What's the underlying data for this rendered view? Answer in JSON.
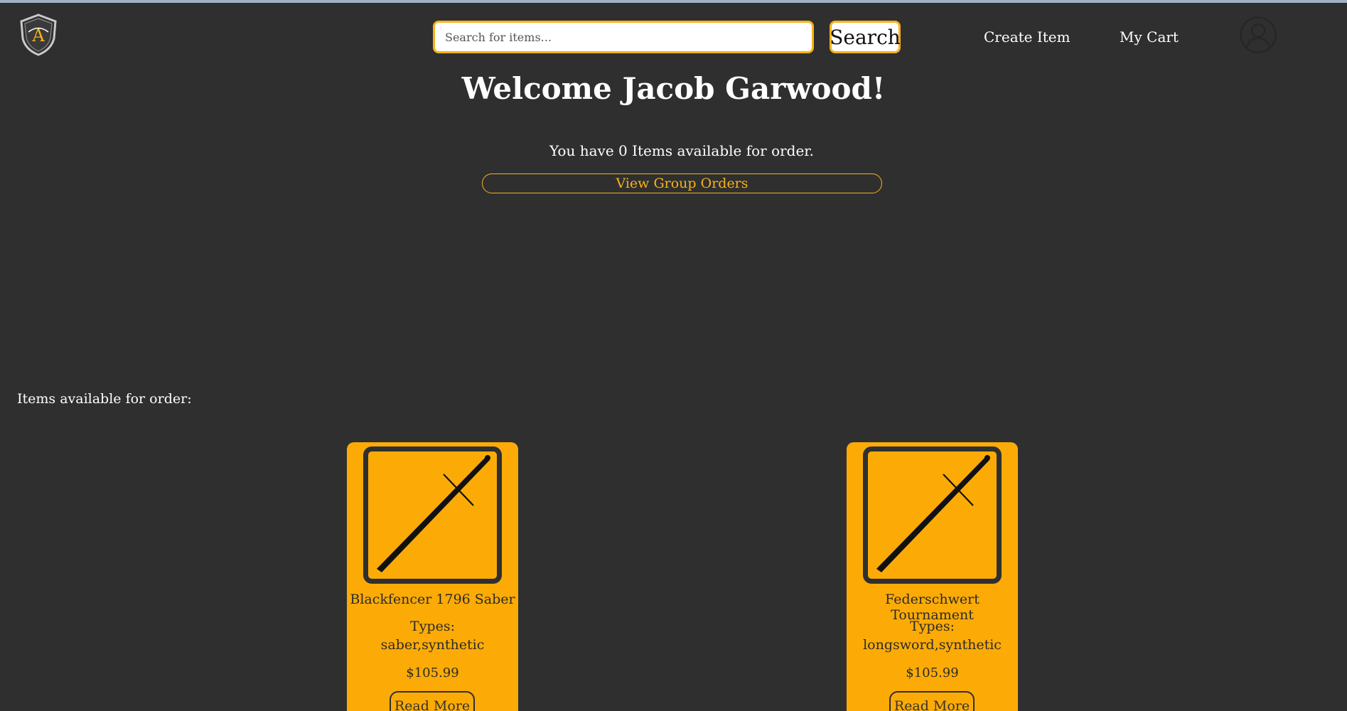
{
  "header": {
    "logo_letter": "A",
    "search": {
      "placeholder": "Search for items...",
      "value": ""
    },
    "search_button_label": "Search",
    "nav": {
      "create_item": "Create Item",
      "my_cart": "My Cart"
    },
    "icons": [
      "logo-shield-icon",
      "user-avatar-icon"
    ]
  },
  "welcome": {
    "title": "Welcome Jacob Garwood!",
    "available_text": "You have 0 Items available for order.",
    "group_orders_label": "View Group Orders"
  },
  "items_section": {
    "label": "Items available for order:",
    "items": [
      {
        "name": "Blackfencer 1796 Saber",
        "types_label": "Types:",
        "types": "saber,synthetic",
        "price": "$105.99",
        "read_more_label": "Read More",
        "icon": "sword-icon"
      },
      {
        "name": "Federschwert Tournament",
        "types_label": "Types:",
        "types": "longsword,synthetic",
        "price": "$105.99",
        "read_more_label": "Read More",
        "icon": "sword-icon"
      }
    ]
  },
  "colors": {
    "background": "#2f2f2f",
    "accent": "#f7b21b",
    "card": "#fcab06",
    "text": "#ffffff"
  }
}
